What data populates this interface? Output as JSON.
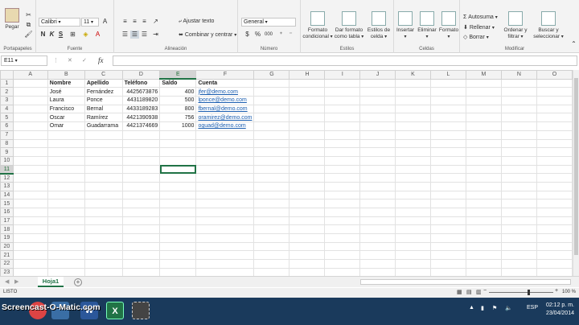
{
  "ribbon": {
    "clipboard": {
      "paste_label": "Pegar",
      "group_label": "Portapapeles"
    },
    "font": {
      "name": "Calibri",
      "size": "11",
      "bold": "N",
      "italic": "K",
      "underline": "S",
      "group_label": "Fuente"
    },
    "alignment": {
      "wrap_text": "Ajustar texto",
      "merge_center": "Combinar y centrar",
      "group_label": "Alineación"
    },
    "number": {
      "format": "General",
      "currency": "$",
      "percent": "%",
      "thousands": "000",
      "group_label": "Número"
    },
    "styles": {
      "conditional": [
        "Formato",
        "condicional"
      ],
      "as_table": [
        "Dar formato",
        "como tabla"
      ],
      "cell_styles": [
        "Estilos de",
        "celda"
      ],
      "group_label": "Estilos"
    },
    "cells": {
      "insert": "Insertar",
      "delete": "Eliminar",
      "format": "Formato",
      "group_label": "Celdas"
    },
    "editing": {
      "autosum": "Autosuma",
      "fill": "Rellenar",
      "clear": "Borrar",
      "sort_filter": [
        "Ordenar y",
        "filtrar"
      ],
      "find_select": [
        "Buscar y",
        "seleccionar"
      ],
      "group_label": "Modificar"
    }
  },
  "formula_bar": {
    "name_box": "E11",
    "cancel_symbol": "✕",
    "enter_symbol": "✓",
    "fx_symbol": "fx",
    "value": ""
  },
  "sheet": {
    "columns": [
      "A",
      "B",
      "C",
      "D",
      "E",
      "F",
      "G",
      "H",
      "I",
      "J",
      "K",
      "L",
      "M",
      "N",
      "O"
    ],
    "selected_column": "E",
    "selected_row": "11",
    "active_cell": "E11",
    "header_row": [
      "",
      "Nombre",
      "Apellido",
      "Teléfono",
      "Saldo",
      "Cuenta"
    ],
    "rows": [
      [
        "",
        "José",
        "Fernández",
        "4425673876",
        "400",
        "jfer@demo.com"
      ],
      [
        "",
        "Laura",
        "Ponce",
        "4431189820",
        "500",
        "lponce@demo.com"
      ],
      [
        "",
        "Francisco",
        "Bernal",
        "4433189283",
        "800",
        "fbernal@demo.com"
      ],
      [
        "",
        "Oscar",
        "Ramírez",
        "4421390938",
        "756",
        "oramirez@demo.com"
      ],
      [
        "",
        "Omar",
        "Guadarrama",
        "4421374669",
        "1000",
        "oguad@demo.com"
      ]
    ],
    "total_rows_visible": 24
  },
  "tabs": {
    "sheet_name": "Hoja1",
    "add_symbol": "+"
  },
  "status": {
    "mode": "LISTO",
    "zoom": "100 %"
  },
  "taskbar": {
    "watermark": "Screencast-O-Matic.com",
    "language": "ESP",
    "time": "02:12 p. m.",
    "date": "23/04/2014"
  },
  "colors": {
    "excel_green": "#217346",
    "link_blue": "#1b5eb0",
    "taskbar": "#1a3a5c"
  }
}
